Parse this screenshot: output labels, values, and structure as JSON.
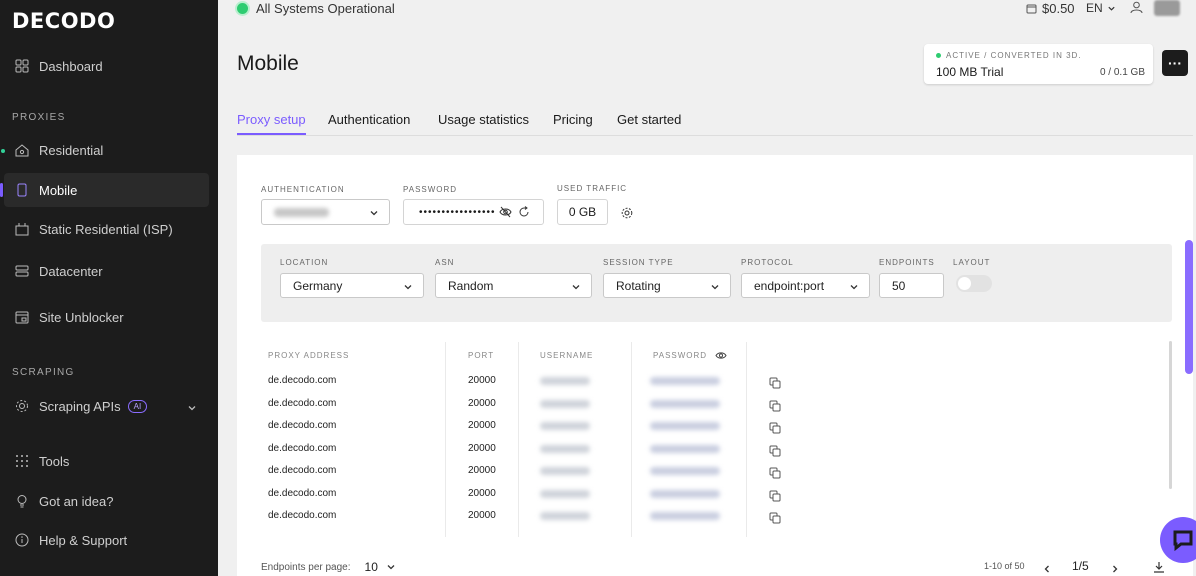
{
  "logo": "DECODO",
  "sidebar": {
    "dashboard": "Dashboard",
    "proxies_label": "PROXIES",
    "residential": "Residential",
    "mobile": "Mobile",
    "isp": "Static Residential (ISP)",
    "datacenter": "Datacenter",
    "unblocker": "Site Unblocker",
    "scraping_label": "SCRAPING",
    "scraping_apis": "Scraping APIs",
    "ai_badge": "AI",
    "tools": "Tools",
    "idea": "Got an idea?",
    "help": "Help & Support"
  },
  "topbar": {
    "status": "All Systems Operational",
    "balance": "$0.50",
    "lang": "EN"
  },
  "header": {
    "title": "Mobile",
    "trial_status": "ACTIVE / CONVERTED IN 3D.",
    "trial_name": "100 MB Trial",
    "trial_usage": "0 / 0.1 GB",
    "more": "···"
  },
  "tabs": [
    "Proxy setup",
    "Authentication",
    "Usage statistics",
    "Pricing",
    "Get started"
  ],
  "auth": {
    "auth_label": "AUTHENTICATION",
    "password_label": "PASSWORD",
    "password_mask": "•••••••••••••••••",
    "traffic_label": "USED TRAFFIC",
    "traffic_value": "0 GB"
  },
  "filters": {
    "location_label": "LOCATION",
    "location_value": "Germany",
    "asn_label": "ASN",
    "asn_value": "Random",
    "session_label": "SESSION TYPE",
    "session_value": "Rotating",
    "protocol_label": "PROTOCOL",
    "protocol_value": "endpoint:port",
    "endpoints_label": "ENDPOINTS",
    "endpoints_value": "50",
    "layout_label": "LAYOUT"
  },
  "table": {
    "headers": [
      "PROXY ADDRESS",
      "PORT",
      "USERNAME",
      "PASSWORD"
    ],
    "rows": [
      {
        "address": "de.decodo.com",
        "port": "20000"
      },
      {
        "address": "de.decodo.com",
        "port": "20000"
      },
      {
        "address": "de.decodo.com",
        "port": "20000"
      },
      {
        "address": "de.decodo.com",
        "port": "20000"
      },
      {
        "address": "de.decodo.com",
        "port": "20000"
      },
      {
        "address": "de.decodo.com",
        "port": "20000"
      },
      {
        "address": "de.decodo.com",
        "port": "20000"
      }
    ]
  },
  "footer": {
    "per_page_label": "Endpoints per page:",
    "per_page_value": "10",
    "range": "1-10 of 50",
    "page": "1/5"
  },
  "colors": {
    "accent": "#7b5cff",
    "sidebar_bg": "#1c1c1c",
    "status_green": "#2ecc71"
  }
}
